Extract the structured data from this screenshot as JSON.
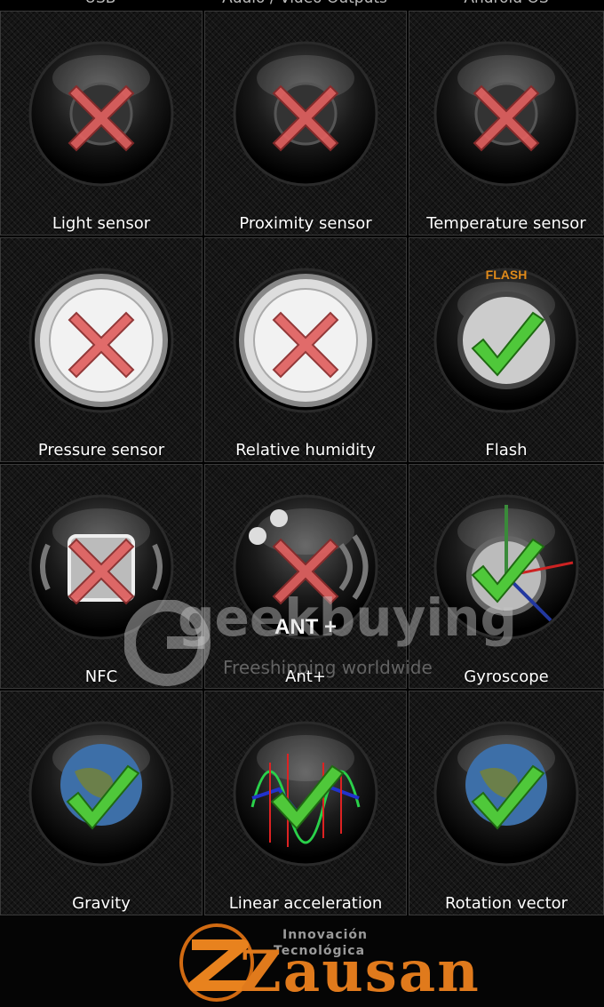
{
  "top_partial_labels": [
    "USB",
    "Audio / Video Outputs",
    "Android OS"
  ],
  "tiles": [
    {
      "label": "Light sensor",
      "icon": "light-sensor-icon",
      "status": "unsupported"
    },
    {
      "label": "Proximity sensor",
      "icon": "proximity-sensor-icon",
      "status": "unsupported"
    },
    {
      "label": "Temperature sensor",
      "icon": "thermometer-icon",
      "status": "unsupported"
    },
    {
      "label": "Pressure sensor",
      "icon": "barometer-icon",
      "status": "unsupported"
    },
    {
      "label": "Relative humidity",
      "icon": "hygrometer-icon",
      "status": "unsupported"
    },
    {
      "label": "Flash",
      "icon": "flash-icon",
      "status": "supported",
      "badge": "FLASH"
    },
    {
      "label": "NFC",
      "icon": "nfc-icon",
      "status": "unsupported"
    },
    {
      "label": "Ant+",
      "icon": "ant-plus-icon",
      "status": "unsupported",
      "badge": "ANT +"
    },
    {
      "label": "Gyroscope",
      "icon": "gyroscope-icon",
      "status": "supported"
    },
    {
      "label": "Gravity",
      "icon": "globe-gravity-icon",
      "status": "supported"
    },
    {
      "label": "Linear acceleration",
      "icon": "waveform-icon",
      "status": "supported"
    },
    {
      "label": "Rotation vector",
      "icon": "rotating-globe-icon",
      "status": "supported"
    }
  ],
  "watermark": {
    "brand": "geekbuying",
    "tagline": "Freeshipping worldwide"
  },
  "footer": {
    "brand": "Zausan",
    "tag_line_1": "Innovación",
    "tag_line_2": "Tecnológica"
  },
  "colors": {
    "cross": "#e0605f",
    "check": "#4fc83a",
    "accent": "#e07a1c"
  }
}
